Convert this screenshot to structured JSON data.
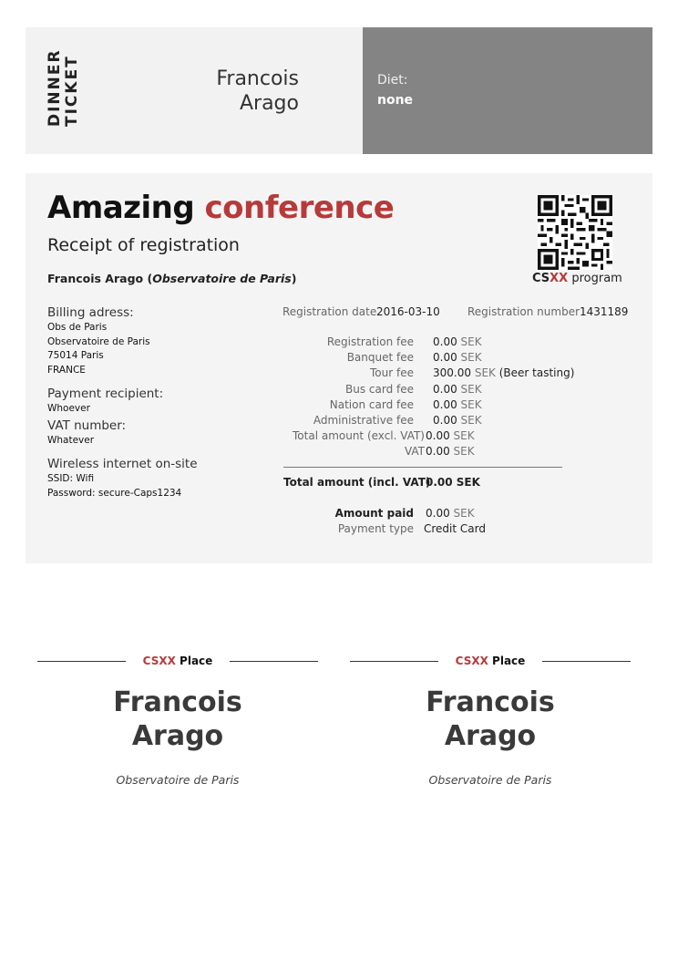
{
  "ticket": {
    "type_line1": "DINNER",
    "type_line2": "TICKET",
    "first_name": "Francois",
    "last_name": "Arago",
    "diet_label": "Diet:",
    "diet_value": "none"
  },
  "receipt": {
    "title_word1": "Amazing",
    "title_word2": "conference",
    "subtitle": "Receipt of registration",
    "attendee_name": "Francois Arago",
    "attendee_org": "Observatoire de Paris",
    "program_prefix": "CS",
    "program_accent": "XX",
    "program_suffix": "program",
    "billing_label": "Billing adress:",
    "billing_lines": [
      "Obs de Paris",
      "Observatoire de Paris",
      "75014 Paris",
      "FRANCE"
    ],
    "payment_recipient_label": "Payment recipient:",
    "payment_recipient_value": "Whoever",
    "vat_number_label": "VAT number:",
    "vat_number_value": "Whatever",
    "wifi_label": "Wireless internet on-site",
    "wifi_ssid": "SSID: Wifi",
    "wifi_password": "Password: secure-Caps1234",
    "registration_date_label": "Registration date",
    "registration_date_value": "2016-03-10",
    "registration_number_label": "Registration number",
    "registration_number_value": "1431189",
    "fees": [
      {
        "label": "Registration fee",
        "amount": "0.00",
        "currency": "SEK",
        "note": ""
      },
      {
        "label": "Banquet fee",
        "amount": "0.00",
        "currency": "SEK",
        "note": ""
      },
      {
        "label": "Tour fee",
        "amount": "300.00",
        "currency": "SEK",
        "note": "(Beer tasting)"
      },
      {
        "label": "Bus card fee",
        "amount": "0.00",
        "currency": "SEK",
        "note": ""
      },
      {
        "label": "Nation card fee",
        "amount": "0.00",
        "currency": "SEK",
        "note": ""
      },
      {
        "label": "Administrative fee",
        "amount": "0.00",
        "currency": "SEK",
        "note": ""
      },
      {
        "label": "Total amount (excl. VAT)",
        "amount": "0.00",
        "currency": "SEK",
        "note": ""
      },
      {
        "label": "VAT",
        "amount": "0.00",
        "currency": "SEK",
        "note": ""
      }
    ],
    "total_label": "Total amount (incl. VAT)",
    "total_value": "0.00 SEK",
    "amount_paid_label": "Amount paid",
    "amount_paid_value": "0.00",
    "amount_paid_currency": "SEK",
    "payment_type_label": "Payment type",
    "payment_type_value": "Credit Card"
  },
  "place_cards": [
    {
      "tag_accent": "CSXX",
      "tag_text": "Place",
      "first_name": "Francois",
      "last_name": "Arago",
      "org": "Observatoire de Paris"
    },
    {
      "tag_accent": "CSXX",
      "tag_text": "Place",
      "first_name": "Francois",
      "last_name": "Arago",
      "org": "Observatoire de Paris"
    }
  ],
  "colors": {
    "accent": "#b73a3a",
    "diet_panel": "#848484",
    "ticket_panel": "#f2f2f2",
    "receipt_panel": "#f4f4f4"
  },
  "icons": {
    "qr_code": "qr-code-icon"
  }
}
